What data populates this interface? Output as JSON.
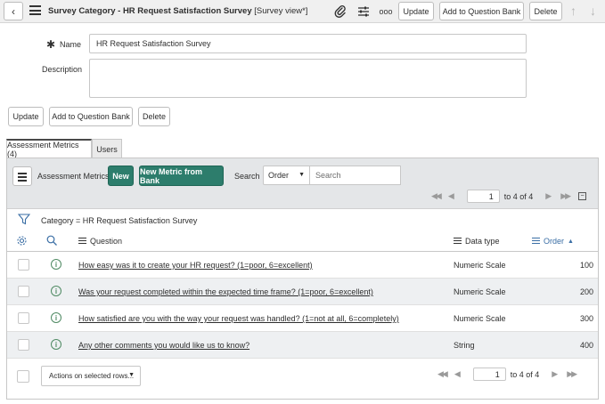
{
  "header": {
    "title": "Survey Category - HR Request Satisfaction Survey",
    "view": "[Survey view*]",
    "update_label": "Update",
    "add_to_bank_label": "Add to Question Bank",
    "delete_label": "Delete",
    "more_label": "ooo"
  },
  "form": {
    "name_label": "Name",
    "name_value": "HR Request Satisfaction Survey",
    "description_label": "Description",
    "description_value": "",
    "update_label": "Update",
    "add_to_bank_label": "Add to Question Bank",
    "delete_label": "Delete"
  },
  "tabs": [
    {
      "label": "Assessment Metrics (4)",
      "active": true
    },
    {
      "label": "Users",
      "active": false
    }
  ],
  "related_list": {
    "title": "Assessment Metrics",
    "new_label": "New",
    "new_from_bank_label": "New Metric from Bank",
    "search_label": "Search",
    "search_field": "Order",
    "search_placeholder": "Search",
    "page_value": "1",
    "page_text": "to 4 of 4",
    "filter_text": "Category = HR Request Satisfaction Survey",
    "columns": {
      "question": "Question",
      "data_type": "Data type",
      "order": "Order"
    },
    "rows": [
      {
        "question": "How easy was it to create your HR request? (1=poor, 6=excellent)",
        "data_type": "Numeric Scale",
        "order": "100"
      },
      {
        "question": "Was your request completed within the expected time frame? (1=poor, 6=excellent)",
        "data_type": "Numeric Scale",
        "order": "200"
      },
      {
        "question": "How satisfied are you with the way your request was handled? (1=not at all, 6=completely)",
        "data_type": "Numeric Scale",
        "order": "300"
      },
      {
        "question": "Any other comments you would like us to know?",
        "data_type": "String",
        "order": "400"
      }
    ],
    "actions_label": "Actions on selected rows...",
    "footer_page_value": "1",
    "footer_page_text": "to 4 of 4"
  },
  "colors": {
    "accent_green": "#2d7d6c",
    "info_green": "#4f8a63",
    "order_blue": "#3a6ea5"
  },
  "icons": [
    "back-icon",
    "menu-icon",
    "paperclip-icon",
    "settings-sliders-icon",
    "more-icon",
    "arrow-up-icon",
    "arrow-down-icon",
    "filter-icon",
    "gear-icon",
    "search-icon",
    "info-icon"
  ]
}
